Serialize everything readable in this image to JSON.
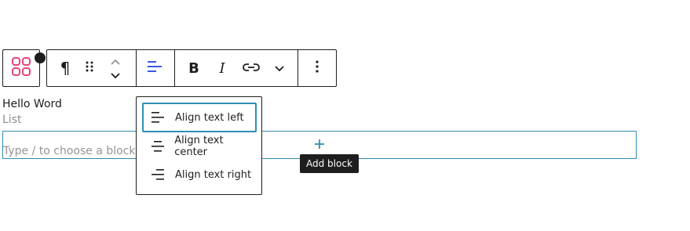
{
  "toolbar": {
    "block_type_icon": "grid-block-icon",
    "paragraph_symbol": "¶",
    "drag_icon": "drag-handle-icon",
    "move_up_icon": "chevron-up-icon",
    "move_down_icon": "chevron-down-icon",
    "align_icon": "align-left-icon",
    "bold_label": "B",
    "italic_label": "I",
    "link_icon": "link-icon",
    "more_icon": "chevron-down-icon",
    "options_icon": "more-vertical-icon",
    "accent_color": "#3858e9",
    "switcher_icon_color": "#e2457a"
  },
  "content": {
    "paragraph_text": "Hello Word",
    "list_label": "List",
    "appender_placeholder": "Type / to choose a block",
    "add_block_tooltip": "Add block"
  },
  "align_menu": {
    "items": [
      {
        "label": "Align text left",
        "icon": "align-left-icon",
        "selected": true
      },
      {
        "label": "Align text center",
        "icon": "align-center-icon",
        "selected": false
      },
      {
        "label": "Align text right",
        "icon": "align-right-icon",
        "selected": false
      }
    ],
    "focus_color": "#2f8db6"
  }
}
